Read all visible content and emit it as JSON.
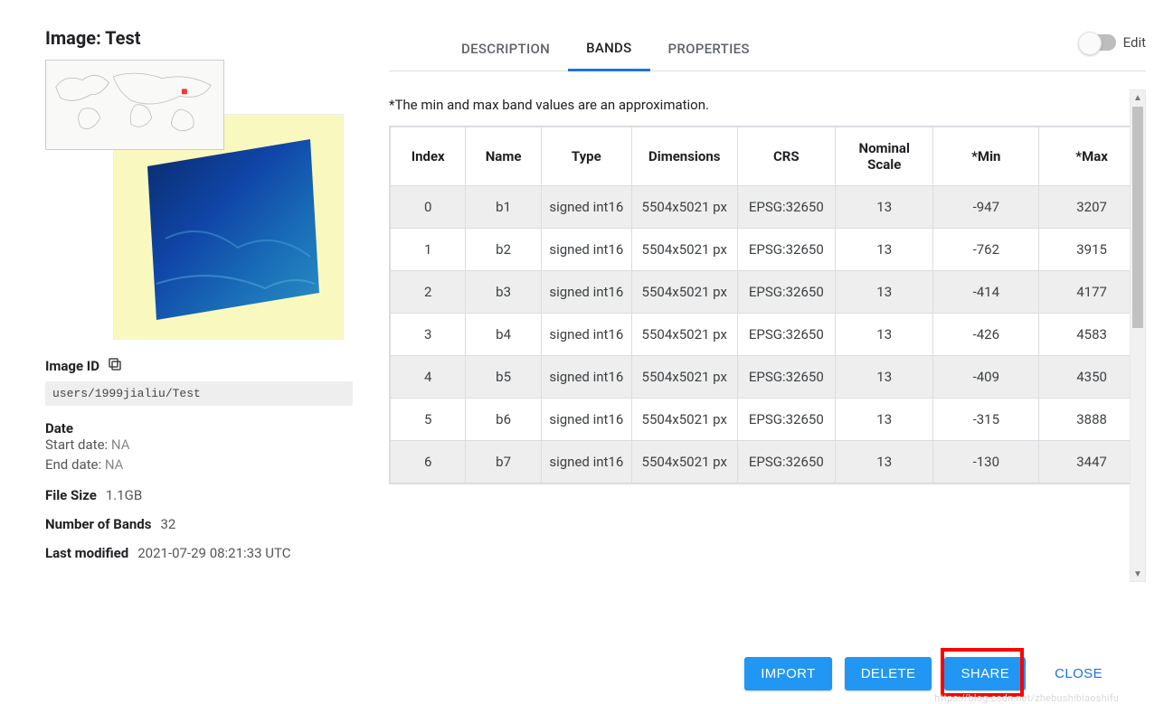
{
  "title": "Image: Test",
  "image_id_label": "Image ID",
  "image_id": "users/1999jialiu/Test",
  "date_label": "Date",
  "start_date_label": "Start date:",
  "start_date": "NA",
  "end_date_label": "End date:",
  "end_date": "NA",
  "file_size_label": "File Size",
  "file_size": "1.1GB",
  "num_bands_label": "Number of Bands",
  "num_bands": "32",
  "last_modified_label": "Last modified",
  "last_modified": "2021-07-29 08:21:33 UTC",
  "tabs": {
    "description": "DESCRIPTION",
    "bands": "BANDS",
    "properties": "PROPERTIES"
  },
  "edit_label": "Edit",
  "note": "*The min and max band values are an approximation.",
  "columns": {
    "index": "Index",
    "name": "Name",
    "type": "Type",
    "dimensions": "Dimensions",
    "crs": "CRS",
    "scale": "Nominal Scale",
    "min": "*Min",
    "max": "*Max"
  },
  "rows": [
    {
      "index": "0",
      "name": "b1",
      "type": "signed int16",
      "dim": "5504x5021 px",
      "crs": "EPSG:32650",
      "scale": "13",
      "min": "-947",
      "max": "3207"
    },
    {
      "index": "1",
      "name": "b2",
      "type": "signed int16",
      "dim": "5504x5021 px",
      "crs": "EPSG:32650",
      "scale": "13",
      "min": "-762",
      "max": "3915"
    },
    {
      "index": "2",
      "name": "b3",
      "type": "signed int16",
      "dim": "5504x5021 px",
      "crs": "EPSG:32650",
      "scale": "13",
      "min": "-414",
      "max": "4177"
    },
    {
      "index": "3",
      "name": "b4",
      "type": "signed int16",
      "dim": "5504x5021 px",
      "crs": "EPSG:32650",
      "scale": "13",
      "min": "-426",
      "max": "4583"
    },
    {
      "index": "4",
      "name": "b5",
      "type": "signed int16",
      "dim": "5504x5021 px",
      "crs": "EPSG:32650",
      "scale": "13",
      "min": "-409",
      "max": "4350"
    },
    {
      "index": "5",
      "name": "b6",
      "type": "signed int16",
      "dim": "5504x5021 px",
      "crs": "EPSG:32650",
      "scale": "13",
      "min": "-315",
      "max": "3888"
    },
    {
      "index": "6",
      "name": "b7",
      "type": "signed int16",
      "dim": "5504x5021 px",
      "crs": "EPSG:32650",
      "scale": "13",
      "min": "-130",
      "max": "3447"
    }
  ],
  "buttons": {
    "import": "IMPORT",
    "delete": "DELETE",
    "share": "SHARE",
    "close": "CLOSE"
  },
  "watermark": "https://blog.csdn.net/zhebushibiaoshifu"
}
